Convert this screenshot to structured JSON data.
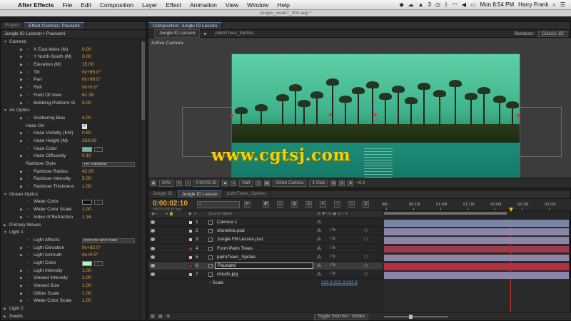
{
  "menubar": {
    "apple": "",
    "app_name": "After Effects",
    "menus": [
      "File",
      "Edit",
      "Composition",
      "Layer",
      "Effect",
      "Animation",
      "View",
      "Window",
      "Help"
    ],
    "clock": "Mon 8:54 PM",
    "user": "Harry Frank",
    "adobe_count": "3"
  },
  "window_title": "Jungle_week7_003.aep *",
  "effects_panel": {
    "tabs": [
      "Project",
      "Effect Controls: Psunami"
    ],
    "subtitle": "Jungle ID Lesson • Psunami",
    "rows": [
      {
        "level": 0,
        "twirl": "▼",
        "label": "Camera"
      },
      {
        "level": 2,
        "twirl": "▶",
        "stopwatch": true,
        "label": "X East-West (M)",
        "value": "0.00"
      },
      {
        "level": 2,
        "twirl": "▶",
        "stopwatch": true,
        "label": "Y North-South (M)",
        "value": "0.00"
      },
      {
        "level": 2,
        "twirl": "▶",
        "stopwatch": true,
        "label": "Elevation (M)",
        "value": "15.00"
      },
      {
        "level": 2,
        "twirl": "▶",
        "stopwatch": true,
        "label": "Tilt",
        "value": "0x+85.0°"
      },
      {
        "level": 2,
        "twirl": "▶",
        "stopwatch": true,
        "label": "Pan",
        "value": "0x+90.0°"
      },
      {
        "level": 2,
        "twirl": "▶",
        "stopwatch": true,
        "label": "Roll",
        "value": "0x+0.0°"
      },
      {
        "level": 2,
        "twirl": "▶",
        "stopwatch": true,
        "label": "Field Of View",
        "value": "61.39"
      },
      {
        "level": 2,
        "twirl": "▶",
        "stopwatch": true,
        "label": "Bobbing Platform Si",
        "value": "0.00"
      },
      {
        "level": 0,
        "twirl": "▼",
        "label": "Air Optics"
      },
      {
        "level": 2,
        "twirl": "▶",
        "stopwatch": true,
        "label": "Scattering Bias",
        "value": "4.00"
      },
      {
        "level": 1,
        "label": "Haze On",
        "check": "✓"
      },
      {
        "level": 2,
        "twirl": "▶",
        "stopwatch": true,
        "label": "Haze Visibilty (KM)",
        "value": "0.60"
      },
      {
        "level": 2,
        "twirl": "▶",
        "stopwatch": true,
        "label": "Haze Height (M)",
        "value": "250.00"
      },
      {
        "level": 2,
        "stopwatch": true,
        "label": "Haze Color",
        "swatch": "#70b8a0"
      },
      {
        "level": 2,
        "twirl": "▶",
        "stopwatch": true,
        "label": "Haze Diffusivity",
        "value": "0.10"
      },
      {
        "level": 1,
        "label": "Rainbow Style",
        "select": "No Rainbow"
      },
      {
        "level": 2,
        "twirl": "▶",
        "stopwatch": true,
        "label": "Rainbow Radius",
        "value": "42.00"
      },
      {
        "level": 2,
        "twirl": "▶",
        "stopwatch": true,
        "label": "Rainbow Intensity",
        "value": "5.00"
      },
      {
        "level": 2,
        "twirl": "▶",
        "stopwatch": true,
        "label": "Rainbow Thickness",
        "value": "1.00"
      },
      {
        "level": 0,
        "twirl": "▼",
        "label": "Ocean Optics"
      },
      {
        "level": 2,
        "stopwatch": true,
        "label": "Water Color",
        "swatch": "#111111"
      },
      {
        "level": 2,
        "twirl": "▶",
        "stopwatch": true,
        "label": "Water Color Scale",
        "value": "1.00"
      },
      {
        "level": 2,
        "twirl": "▶",
        "stopwatch": true,
        "label": "Index of Refraction",
        "value": "1.34"
      },
      {
        "level": 0,
        "twirl": "▶",
        "label": "Primary Waves"
      },
      {
        "level": 0,
        "twirl": "▼",
        "label": "Light 1"
      },
      {
        "level": 2,
        "stopwatch": true,
        "label": "Light Affects:",
        "select": "Both Air and Wate"
      },
      {
        "level": 2,
        "twirl": "▶",
        "stopwatch": true,
        "label": "Light Elevation",
        "value": "0x+82.0°"
      },
      {
        "level": 2,
        "twirl": "▶",
        "stopwatch": true,
        "label": "Light Azimuth",
        "value": "0x+0.0°"
      },
      {
        "level": 2,
        "stopwatch": true,
        "label": "Light Color",
        "swatch": "#b8f0c0"
      },
      {
        "level": 2,
        "twirl": "▶",
        "stopwatch": true,
        "label": "Light Intensity",
        "value": "1.00"
      },
      {
        "level": 2,
        "twirl": "▶",
        "stopwatch": true,
        "label": "Viewed Intensity",
        "value": "1.00"
      },
      {
        "level": 2,
        "twirl": "▶",
        "stopwatch": true,
        "label": "Viewed Size",
        "value": "1.00"
      },
      {
        "level": 2,
        "twirl": "▶",
        "stopwatch": true,
        "label": "Glitter Scale",
        "value": "1.00"
      },
      {
        "level": 2,
        "twirl": "▶",
        "stopwatch": true,
        "label": "Water Color Scale",
        "value": "1.00"
      },
      {
        "level": 0,
        "twirl": "▶",
        "label": "Light 2"
      },
      {
        "level": 0,
        "twirl": "▶",
        "label": "Swells"
      }
    ]
  },
  "comp_panel": {
    "tab": "Composition: Jungle ID Lesson",
    "sub_tabs": [
      "Jungle ID Lesson",
      "palmTrees_Sprites"
    ],
    "renderer_label": "Renderer:",
    "renderer_value": "Classic 3D",
    "active_camera": "Active Camera",
    "watermark": "www.cgtsj.com",
    "footer": {
      "zoom": "50%",
      "timecode": "0:00:02:10",
      "resolution": "Half",
      "view": "Active Camera",
      "views": "1 View",
      "exposure": "+0.0"
    }
  },
  "timeline": {
    "tabs": [
      "Jungle ID",
      "Jungle ID Lesson",
      "palmTrees_Sprites"
    ],
    "timecode": "0:00:02:10",
    "frames": "00070 (29.97 fps)",
    "search_placeholder": "",
    "col_source": "Source Name",
    "ruler": [
      "00f",
      "00:15f",
      "01:00f",
      "01:15f",
      "02:00f",
      "02:15f",
      "03:00f"
    ],
    "layers": [
      {
        "num": "1",
        "name": "Camera 1",
        "label_color": "#d8c8d8",
        "bar": "#7a86a6"
      },
      {
        "num": "2",
        "name": "shoreline.psd",
        "label_color": "#c8b8d0",
        "bar": "#8b86a8"
      },
      {
        "num": "3",
        "name": "Jungle Fill Lesson.psd",
        "label_color": "#c8b8d0",
        "bar": "#8b86a8"
      },
      {
        "num": "4",
        "name": "Form Palm Trees",
        "label_color": "#9a2a3a",
        "bar": "#9a3a4a"
      },
      {
        "num": "5",
        "name": "palmTrees_Sprites",
        "label_color": "#c8b8d0",
        "bar": "#8b86a8"
      },
      {
        "num": "6",
        "name": "Psunami",
        "label_color": "#b02030",
        "bar": "#b43040",
        "selected": true
      },
      {
        "num": "7",
        "name": "clouds.jpg",
        "label_color": "#c8b8d0",
        "bar": "#8b86a8"
      }
    ],
    "scale_label": "Scale",
    "scale_value": "222.3,222.3,222.3",
    "toggle": "Toggle Switches / Modes"
  }
}
